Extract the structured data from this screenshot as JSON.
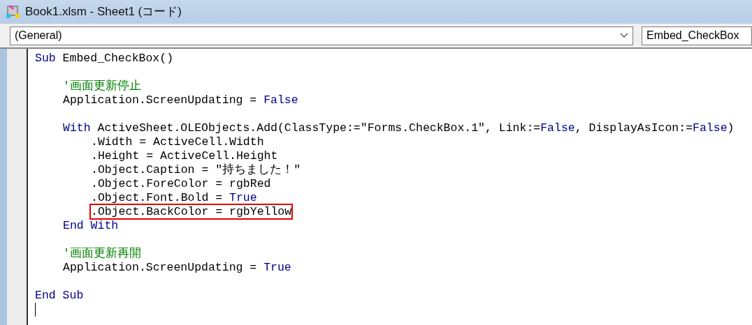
{
  "window": {
    "title": "Book1.xlsm - Sheet1 (コード)"
  },
  "object_dropdown": {
    "value": "(General)"
  },
  "procedure_dropdown": {
    "value": "Embed_CheckBox"
  },
  "code": [
    {
      "kind": "code",
      "boxed": false,
      "tokens": [
        {
          "kind": "keyword",
          "text": "Sub"
        },
        {
          "kind": "plain",
          "text": " Embed_CheckBox()"
        }
      ],
      "children": [
        {
          "kind": "blank"
        },
        {
          "kind": "code",
          "boxed": false,
          "tokens": [
            {
              "kind": "comment",
              "text": "'画面更新停止"
            }
          ]
        },
        {
          "kind": "code",
          "boxed": false,
          "tokens": [
            {
              "kind": "plain",
              "text": "Application.ScreenUpdating = "
            },
            {
              "kind": "keyword",
              "text": "False"
            }
          ]
        },
        {
          "kind": "blank"
        },
        {
          "kind": "code",
          "boxed": false,
          "tokens": [
            {
              "kind": "keyword",
              "text": "With"
            },
            {
              "kind": "plain",
              "text": " ActiveSheet.OLEObjects.Add(ClassType:=\"Forms.CheckBox.1\", Link:="
            },
            {
              "kind": "keyword",
              "text": "False"
            },
            {
              "kind": "plain",
              "text": ", DisplayAsIcon:="
            },
            {
              "kind": "keyword",
              "text": "False"
            },
            {
              "kind": "plain",
              "text": ")"
            }
          ],
          "children": [
            {
              "kind": "code",
              "boxed": false,
              "tokens": [
                {
                  "kind": "plain",
                  "text": ".Width = ActiveCell.Width"
                }
              ]
            },
            {
              "kind": "code",
              "boxed": false,
              "tokens": [
                {
                  "kind": "plain",
                  "text": ".Height = ActiveCell.Height"
                }
              ]
            },
            {
              "kind": "code",
              "boxed": false,
              "tokens": [
                {
                  "kind": "plain",
                  "text": ".Object.Caption = \"持ちました！\""
                }
              ]
            },
            {
              "kind": "code",
              "boxed": false,
              "tokens": [
                {
                  "kind": "plain",
                  "text": ".Object.ForeColor = rgbRed"
                }
              ]
            },
            {
              "kind": "code",
              "boxed": false,
              "tokens": [
                {
                  "kind": "plain",
                  "text": ".Object.Font.Bold = "
                },
                {
                  "kind": "keyword",
                  "text": "True"
                }
              ]
            },
            {
              "kind": "code",
              "boxed": true,
              "tokens": [
                {
                  "kind": "plain",
                  "text": ".Object.BackColor = rgbYellow"
                }
              ]
            }
          ]
        },
        {
          "kind": "code",
          "boxed": false,
          "tokens": [
            {
              "kind": "keyword",
              "text": "End"
            },
            {
              "kind": "keyword",
              "text": " With"
            }
          ]
        },
        {
          "kind": "blank"
        },
        {
          "kind": "code",
          "boxed": false,
          "tokens": [
            {
              "kind": "comment",
              "text": "'画面更新再開"
            }
          ]
        },
        {
          "kind": "code",
          "boxed": false,
          "tokens": [
            {
              "kind": "plain",
              "text": "Application.ScreenUpdating = "
            },
            {
              "kind": "keyword",
              "text": "True"
            }
          ]
        },
        {
          "kind": "blank"
        }
      ]
    },
    {
      "kind": "code",
      "boxed": false,
      "tokens": [
        {
          "kind": "keyword",
          "text": "End"
        },
        {
          "kind": "keyword",
          "text": " Sub"
        }
      ]
    },
    {
      "kind": "cursor"
    }
  ]
}
